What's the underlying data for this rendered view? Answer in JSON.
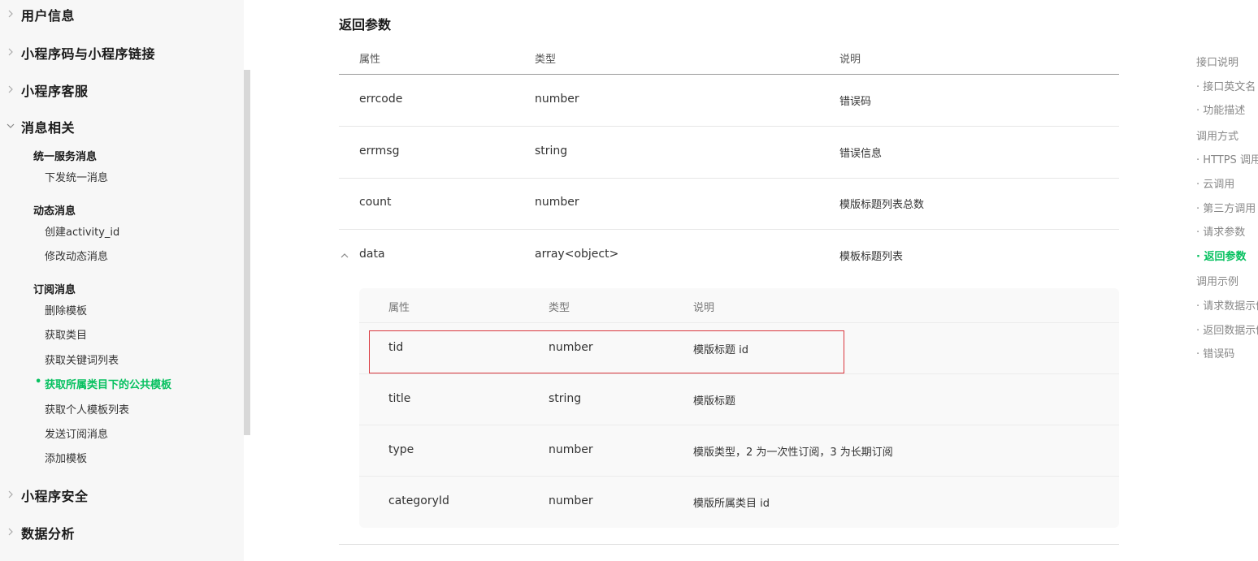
{
  "sidebar": {
    "groups": [
      {
        "label": "用户信息",
        "expanded": false
      },
      {
        "label": "小程序码与小程序链接",
        "expanded": false
      },
      {
        "label": "小程序客服",
        "expanded": false
      },
      {
        "label": "消息相关",
        "expanded": true
      },
      {
        "label": "小程序安全",
        "expanded": false
      },
      {
        "label": "数据分析",
        "expanded": false
      }
    ],
    "subsections": [
      {
        "title": "统一服务消息",
        "items": [
          "下发统一消息"
        ]
      },
      {
        "title": "动态消息",
        "items": [
          "创建activity_id",
          "修改动态消息"
        ]
      },
      {
        "title": "订阅消息",
        "items": [
          "删除模板",
          "获取类目",
          "获取关键词列表",
          "获取所属类目下的公共模板",
          "获取个人模板列表",
          "发送订阅消息",
          "添加模板"
        ]
      }
    ],
    "active_item": "获取所属类目下的公共模板",
    "active_marker": "•"
  },
  "main": {
    "section_title": "返回参数",
    "headers": [
      "属性",
      "类型",
      "说明"
    ],
    "rows": [
      {
        "name": "errcode",
        "type": "number",
        "desc": "错误码"
      },
      {
        "name": "errmsg",
        "type": "string",
        "desc": "错误信息"
      },
      {
        "name": "count",
        "type": "number",
        "desc": "模版标题列表总数"
      },
      {
        "name": "data",
        "type": "array<object>",
        "desc": "模板标题列表",
        "expanded": true
      }
    ],
    "nested": {
      "headers": [
        "属性",
        "类型",
        "说明"
      ],
      "rows": [
        {
          "name": "tid",
          "type": "number",
          "desc": "模版标题 id",
          "highlighted": true
        },
        {
          "name": "title",
          "type": "string",
          "desc": "模版标题"
        },
        {
          "name": "type",
          "type": "number",
          "desc": "模版类型，2 为一次性订阅，3 为长期订阅"
        },
        {
          "name": "categoryId",
          "type": "number",
          "desc": "模版所属类目 id"
        }
      ]
    }
  },
  "toc": {
    "items": [
      {
        "label": "接口说明",
        "level": 1
      },
      {
        "label": "· 接口英文名",
        "level": 2
      },
      {
        "label": "· 功能描述",
        "level": 2
      },
      {
        "label": "调用方式",
        "level": 1
      },
      {
        "label": "· HTTPS 调用",
        "level": 2
      },
      {
        "label": "· 云调用",
        "level": 2
      },
      {
        "label": "· 第三方调用",
        "level": 2
      },
      {
        "label": "· 请求参数",
        "level": 2
      },
      {
        "label": "· 返回参数",
        "level": 2,
        "active": true
      },
      {
        "label": "调用示例",
        "level": 1
      },
      {
        "label": "· 请求数据示例",
        "level": 2
      },
      {
        "label": "· 返回数据示例",
        "level": 2
      },
      {
        "label": "· 错误码",
        "level": 2
      }
    ]
  },
  "colors": {
    "accent": "#07c160",
    "highlight_border": "#d9363e"
  },
  "icons": {
    "collapsed": "chevron-right-icon",
    "expanded": "chevron-down-icon",
    "row_expanded": "chevron-up-icon"
  }
}
